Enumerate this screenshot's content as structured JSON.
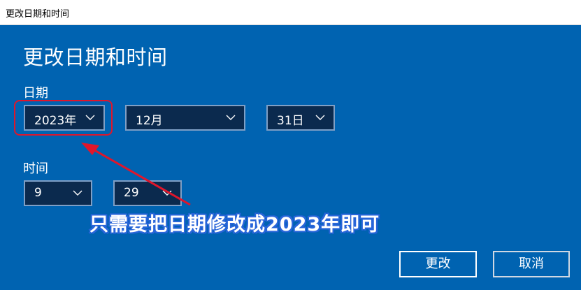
{
  "window": {
    "title": "更改日期和时间"
  },
  "panel": {
    "heading": "更改日期和时间",
    "date_label": "日期",
    "time_label": "时间",
    "year": "2023年",
    "month": "12月",
    "day": "31日",
    "hour": "9",
    "minute": "29",
    "annotation": "只需要把日期修改成2023年即可"
  },
  "buttons": {
    "change": "更改",
    "cancel": "取消"
  },
  "colors": {
    "panel_bg": "#0063b1",
    "dropdown_bg": "#0b2a4e",
    "highlight": "#e0162b"
  },
  "icons": {
    "dropdown": "chevron-down-icon",
    "annotation_arrow": "arrow-icon"
  }
}
